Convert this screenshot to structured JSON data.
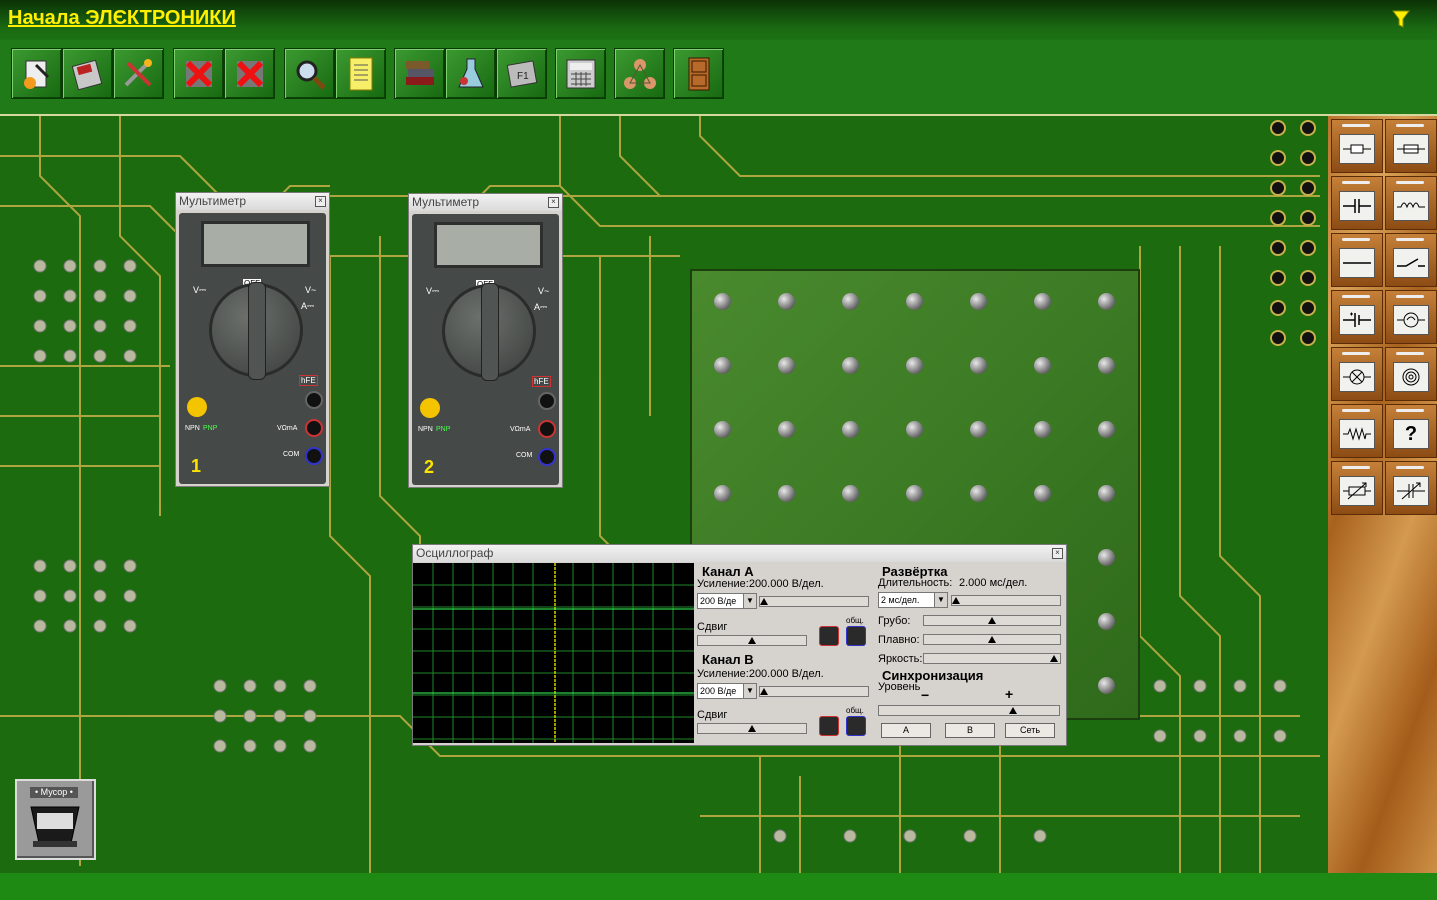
{
  "app": {
    "title": "Начала ЭЛЄКТРОНИКИ"
  },
  "toolbar": {
    "buttons": [
      {
        "name": "new-scheme",
        "icon": "magic-icon"
      },
      {
        "name": "save",
        "icon": "floppy-icon"
      },
      {
        "name": "tools",
        "icon": "tools-icon"
      },
      {
        "name": "delete-1",
        "icon": "delete-cross-icon"
      },
      {
        "name": "delete-2",
        "icon": "delete-cross-icon"
      },
      {
        "name": "search",
        "icon": "magnifier-icon"
      },
      {
        "name": "notes",
        "icon": "notepad-icon"
      },
      {
        "name": "books",
        "icon": "books-icon"
      },
      {
        "name": "lab",
        "icon": "flask-icon"
      },
      {
        "name": "help",
        "icon": "help-key-icon"
      },
      {
        "name": "calculator",
        "icon": "calculator-icon"
      },
      {
        "name": "molecule",
        "icon": "molecule-icon"
      },
      {
        "name": "exit",
        "icon": "door-icon"
      }
    ]
  },
  "multimeter1": {
    "title": "Мультиметр",
    "number": "1",
    "labels": {
      "v_dc": "V⎓",
      "v_ac": "V~",
      "off": "OFF",
      "a_dc": "A⎓",
      "hfe": "hFE",
      "com": "COM",
      "npn": "NPN",
      "pnp": "PNP",
      "v_ohm": "VΩmA"
    }
  },
  "multimeter2": {
    "title": "Мультиметр",
    "number": "2",
    "labels": {
      "v_dc": "V⎓",
      "v_ac": "V~",
      "off": "OFF",
      "a_dc": "A⎓",
      "hfe": "hFE",
      "com": "COM",
      "npn": "NPN",
      "pnp": "PNP",
      "v_ohm": "VΩmA"
    }
  },
  "oscilloscope": {
    "title": "Осциллограф",
    "channel_a": {
      "header": "Канал А",
      "gain_label": "Усиление:200.000 В/дел.",
      "gain_select": "200 В/де",
      "shift_label": "Сдвиг",
      "common_label": "общ."
    },
    "channel_b": {
      "header": "Канал В",
      "gain_label": "Усиление:200.000 В/дел.",
      "gain_select": "200 В/де",
      "shift_label": "Сдвиг",
      "common_label": "общ."
    },
    "sweep": {
      "header": "Развёртка",
      "duration_label": "Длительность:",
      "duration_value": "2.000 мс/дел.",
      "select": "2 мс/дел.",
      "coarse": "Грубо:",
      "fine": "Плавно:",
      "brightness": "Яркость:"
    },
    "sync": {
      "header": "Синхронизация",
      "level_label": "Уровень",
      "minus": "−",
      "plus": "+",
      "btn_a": "A",
      "btn_b": "B",
      "btn_net": "Сеть"
    }
  },
  "trash": {
    "label": "• Мусор •"
  },
  "palette": {
    "items": [
      "fuse",
      "fuse-2",
      "capacitor",
      "inductor",
      "wire",
      "switch",
      "electrolytic-capacitor",
      "lamp",
      "bulb",
      "coil",
      "resistor",
      "unknown",
      "variable-resistor",
      "variable-capacitor"
    ],
    "unknown_label": "?"
  },
  "colors": {
    "board": "#1c6a10",
    "title": "#ffef00",
    "toolbar": "#1f7a17"
  }
}
